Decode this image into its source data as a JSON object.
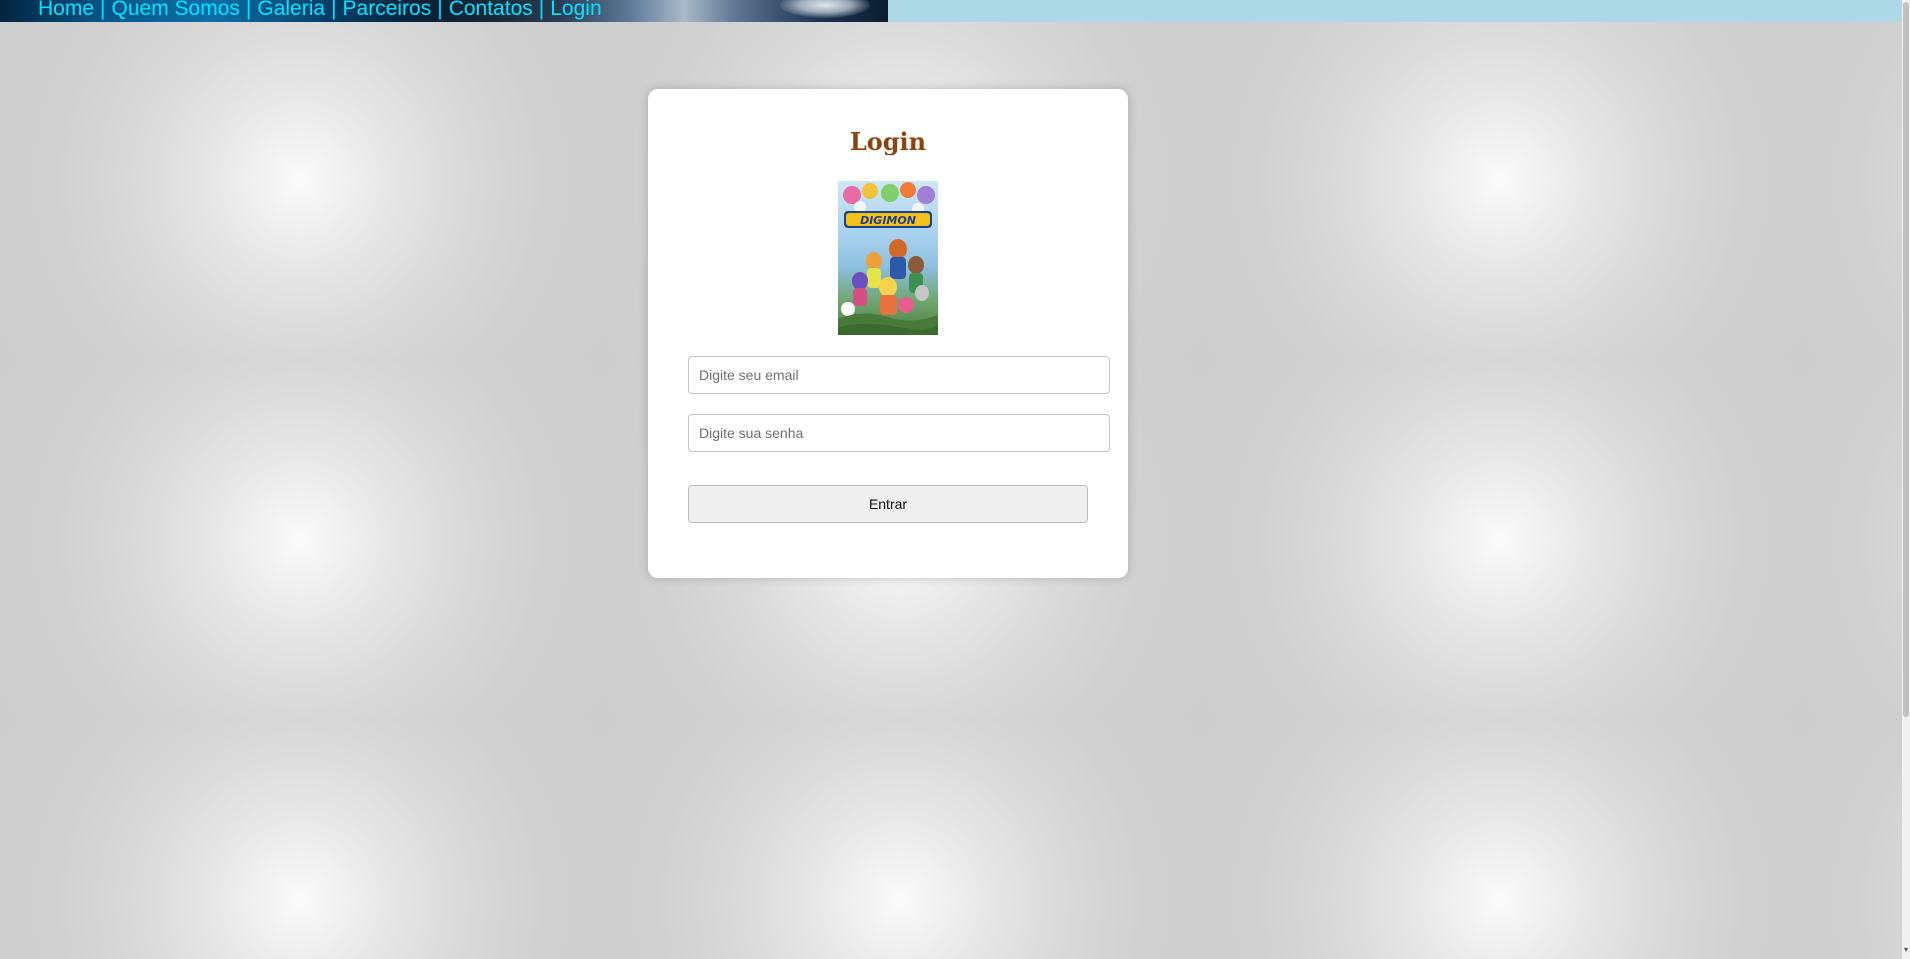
{
  "nav": {
    "items": [
      {
        "label": "Home"
      },
      {
        "label": "Quem Somos"
      },
      {
        "label": "Galeria"
      },
      {
        "label": "Parceiros"
      },
      {
        "label": "Contatos"
      },
      {
        "label": "Login"
      }
    ],
    "separator": "|",
    "link_color": "#00e5ff",
    "bar_color": "#add8e6"
  },
  "login": {
    "title": "Login",
    "title_color": "#8b4513",
    "poster": {
      "label": "DIGIMON"
    },
    "email_placeholder": "Digite seu email",
    "password_placeholder": "Digite sua senha",
    "submit_label": "Entrar"
  },
  "icons": {
    "scroll_down": "scroll-down-arrow-icon"
  }
}
